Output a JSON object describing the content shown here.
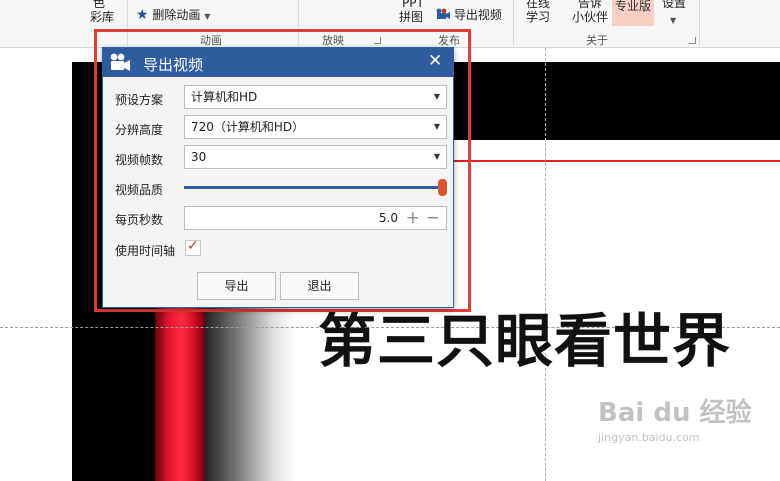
{
  "ribbon": {
    "palette_label_top": "色",
    "palette_label": "彩库",
    "delete_animation": "删除动画",
    "ppt_label_top": "PPT",
    "ppt_label": "拼图",
    "export_video": "导出视频",
    "online_top": "在线",
    "online_bottom": "学习",
    "tell_top": "告诉",
    "tell_bottom": "小伙伴",
    "pro_edition": "专业版",
    "settings": "设置",
    "groups": {
      "animation": "动画",
      "playback": "放映",
      "publish": "发布",
      "about": "关于"
    }
  },
  "slide": {
    "title": "第三只眼看世界"
  },
  "watermark": {
    "logo": "Bai du 经验",
    "url": "jingyan.baidu.com"
  },
  "dialog": {
    "title": "导出视频",
    "preset_label": "预设方案",
    "preset_value": "计算机和HD",
    "resolution_label": "分辨高度",
    "resolution_value": "720（计算机和HD）",
    "fps_label": "视频帧数",
    "fps_value": "30",
    "quality_label": "视频品质",
    "quality_level": 1.0,
    "seconds_label": "每页秒数",
    "seconds_value": "5.0",
    "timeline_label": "使用时间轴",
    "timeline_checked": true,
    "export_button": "导出",
    "exit_button": "退出"
  },
  "colors": {
    "title_bar": "#2e5c9e",
    "highlight": "#e53a3a",
    "slider_thumb": "#d9532f",
    "check_mark": "#c0392b"
  }
}
